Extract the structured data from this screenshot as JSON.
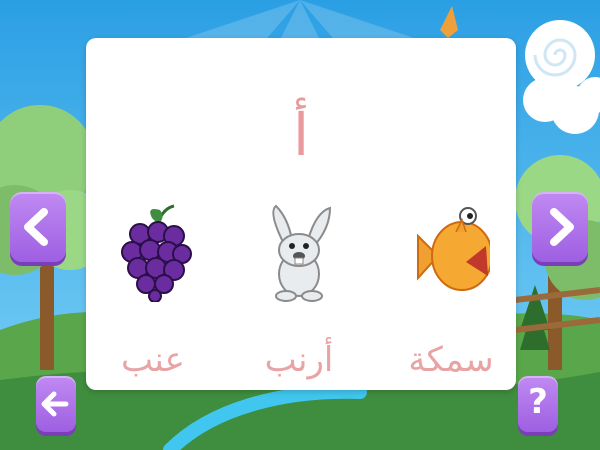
{
  "card": {
    "letter": "أ",
    "items": [
      {
        "word": "عنب",
        "icon": "grapes-icon"
      },
      {
        "word": "أرنب",
        "icon": "rabbit-icon"
      },
      {
        "word": "سمكة",
        "icon": "fish-icon"
      }
    ]
  },
  "controls": {
    "previous_icon": "chevron-left-icon",
    "next_icon": "chevron-right-icon",
    "back_icon": "arrow-left-icon",
    "help_label": "?"
  },
  "colors": {
    "sky": "#3fb2ec",
    "grass": "#3f8d3f",
    "button": "#a86ce8",
    "text_pink": "#e8a3a4",
    "river": "#41c7ef"
  }
}
